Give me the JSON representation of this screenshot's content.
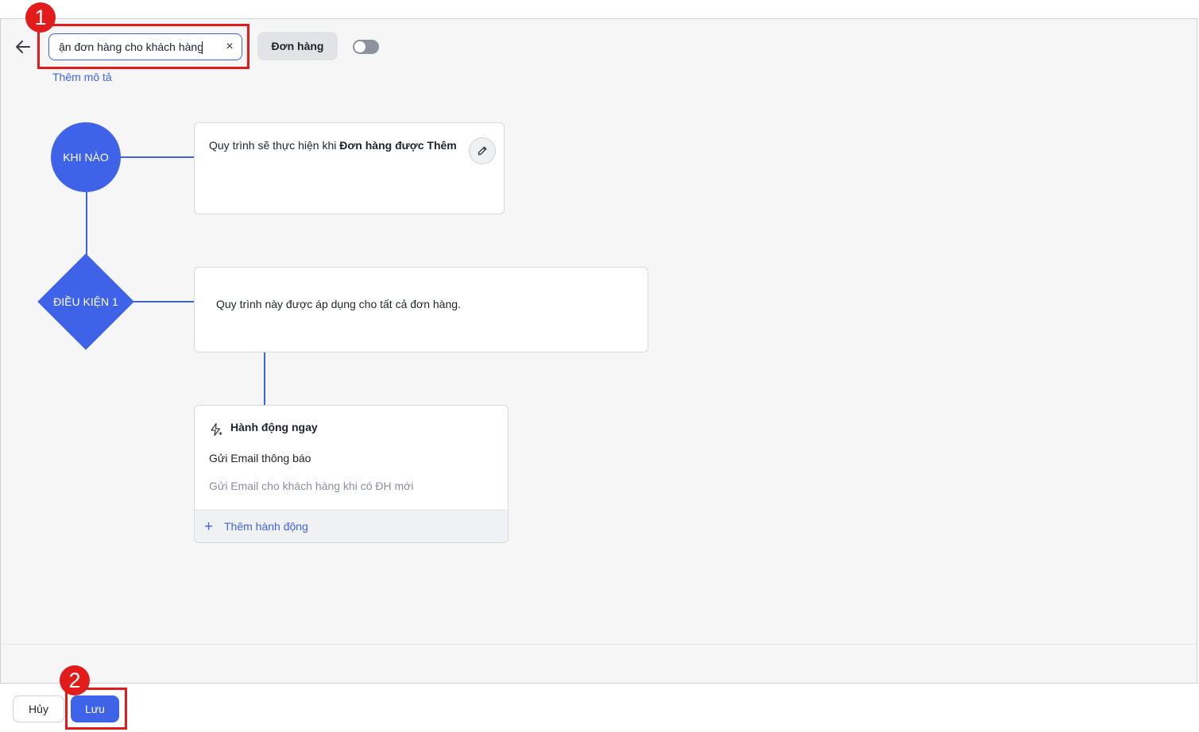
{
  "header": {
    "workflow_name": "ận đơn hàng cho khách hàng",
    "clear_symbol": "×",
    "entity_tag": "Đơn hàng",
    "add_description": "Thêm mô tả"
  },
  "flow": {
    "trigger_node": "KHI NÀO",
    "trigger_text_prefix": "Quy trình sẽ thực hiện khi ",
    "trigger_text_bold": "Đơn hàng được Thêm",
    "condition_node": "ĐIỀU KIỆN 1",
    "condition_text": "Quy trình này được áp dụng cho tất cả đơn hàng.",
    "action_header": "Hành động ngay",
    "action_title": "Gửi Email thông báo",
    "action_desc": "Gửi Email cho khách hàng khi có ĐH mới",
    "add_action_plus": "+",
    "add_action": "Thêm hành động"
  },
  "footer": {
    "cancel_label": "Hủy",
    "save_label": "Lưu"
  },
  "annotations": {
    "badge_1": "1",
    "badge_2": "2"
  },
  "state": {
    "active_toggle_on": false
  },
  "icons": {
    "back": "arrow-left-icon",
    "edit": "pencil-icon",
    "action": "lightning-sparkle-icon"
  },
  "colors": {
    "accent": "#3f63e8",
    "annotation": "#e21b1b",
    "canvas_bg": "#f6f6f7"
  }
}
